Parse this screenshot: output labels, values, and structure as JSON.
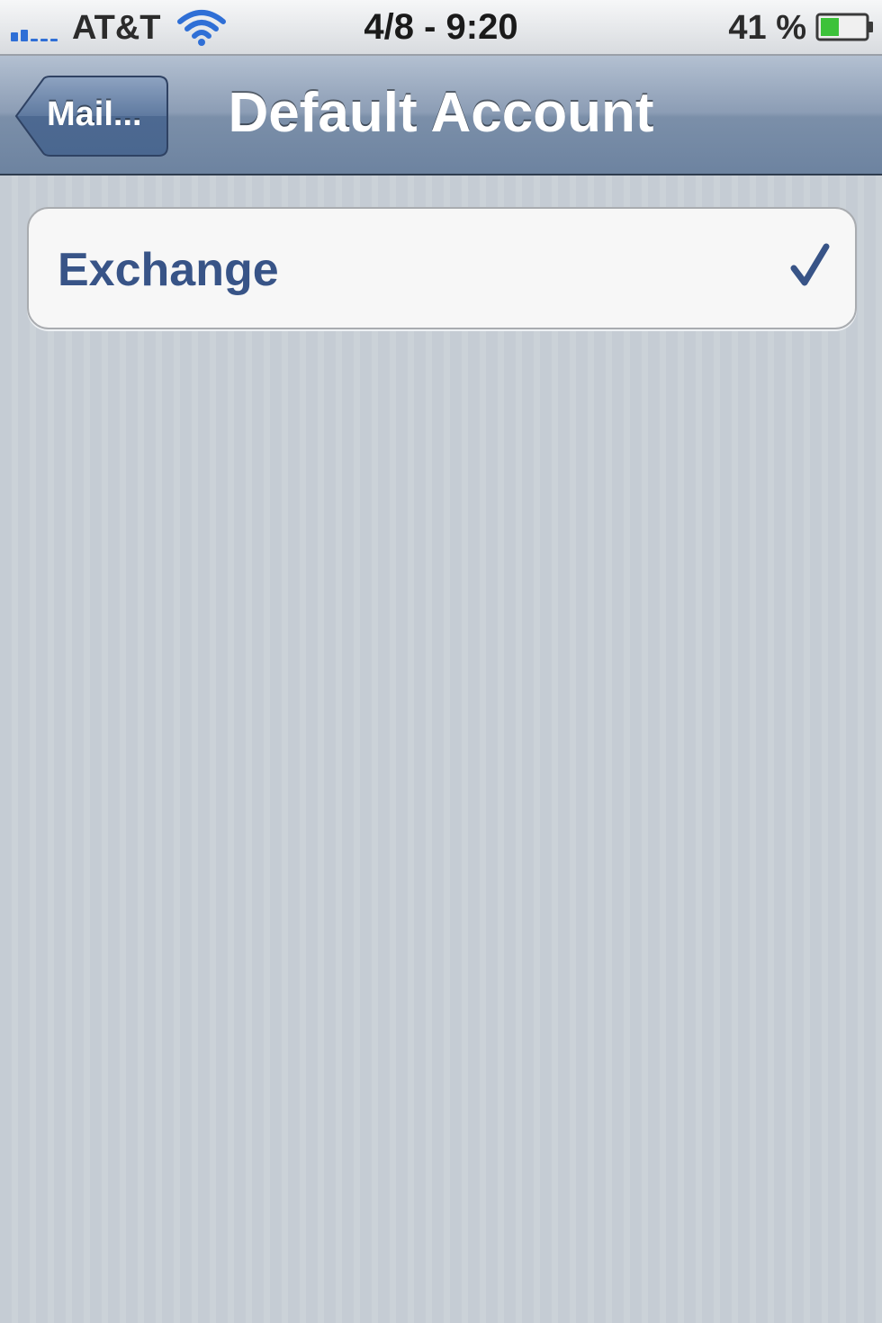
{
  "status_bar": {
    "carrier": "AT&T",
    "time": "4/8 - 9:20",
    "battery_percent": "41 %",
    "battery_level": 0.41,
    "signal_icon": "signal-bars-icon",
    "wifi_icon": "wifi-icon",
    "battery_icon": "battery-icon"
  },
  "nav_bar": {
    "back_label": "Mail...",
    "title": "Default Account"
  },
  "accounts": {
    "items": [
      {
        "label": "Exchange",
        "selected": true,
        "accessory_icon": "checkmark-icon"
      }
    ]
  },
  "colors": {
    "nav_tint": "#6d83a0",
    "cell_text": "#385487",
    "background": "#c5ccd4",
    "battery_fill": "#3dc23a",
    "signal_active": "#2f6fd6"
  }
}
